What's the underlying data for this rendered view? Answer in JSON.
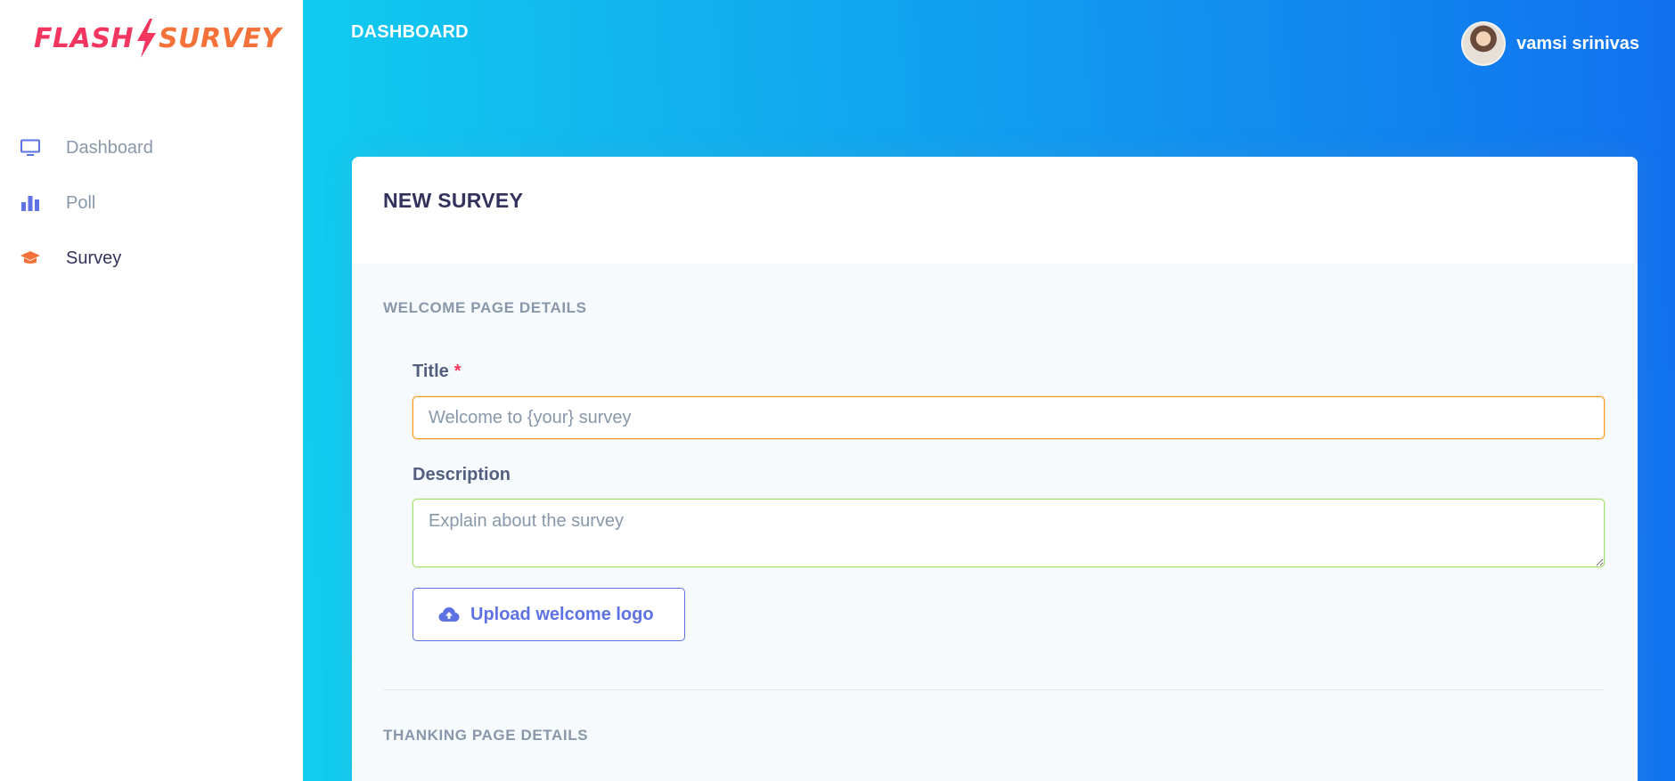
{
  "brand": {
    "word1": "FLASH",
    "word2": "SURVEY"
  },
  "sidebar": {
    "items": [
      {
        "label": "Dashboard",
        "icon": "monitor-icon",
        "active": false
      },
      {
        "label": "Poll",
        "icon": "bar-chart-icon",
        "active": false
      },
      {
        "label": "Survey",
        "icon": "graduation-cap-icon",
        "active": true
      }
    ]
  },
  "header": {
    "title": "DASHBOARD",
    "user_name": "vamsi srinivas"
  },
  "card": {
    "title": "NEW SURVEY",
    "welcome_section": "WELCOME PAGE DETAILS",
    "title_field": {
      "label": "Title",
      "required_mark": "*",
      "placeholder": "Welcome to {your} survey"
    },
    "description_field": {
      "label": "Description",
      "placeholder": "Explain about the survey"
    },
    "upload_button": "Upload welcome logo",
    "thanking_section": "THANKING PAGE DETAILS"
  },
  "colors": {
    "gradient_start": "#11cdef",
    "gradient_end": "#1171ef",
    "primary": "#5e72e4",
    "danger": "#f5365c",
    "warning": "#fb9b1f"
  }
}
